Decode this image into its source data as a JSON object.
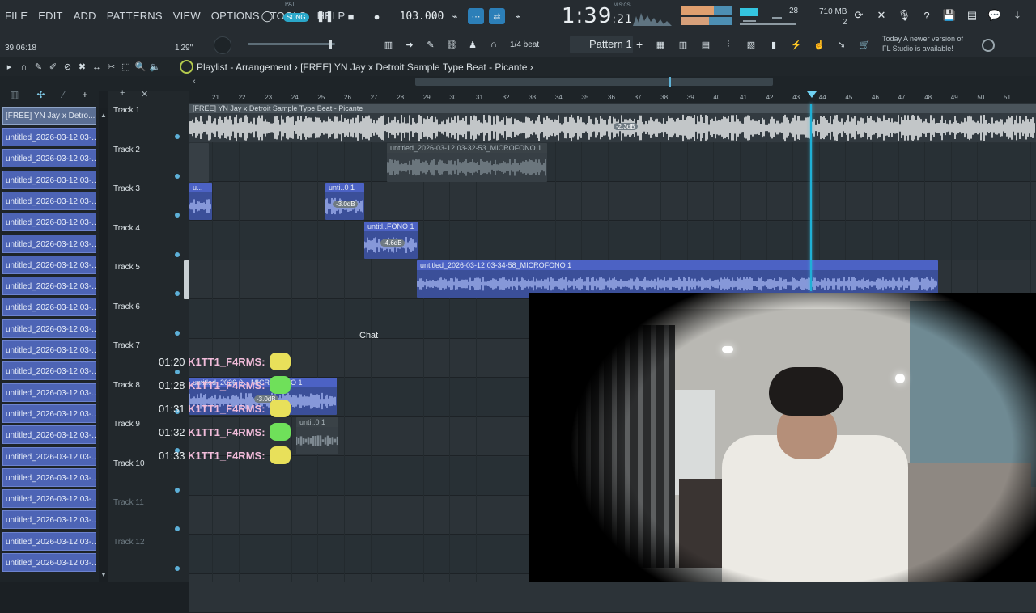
{
  "menu": [
    "FILE",
    "EDIT",
    "ADD",
    "PATTERNS",
    "VIEW",
    "OPTIONS",
    "TOOLS",
    "HELP"
  ],
  "transport": {
    "pat_label": "PAT",
    "song_label": "SONG",
    "tempo": "103.000",
    "time_main": "1:39",
    "time_sub": ":21",
    "time_unit": "M:S:CS"
  },
  "meters": {
    "cpu": "28",
    "memory": "710 MB",
    "poly": "2"
  },
  "secondbar": {
    "elapsed": "39:06:18",
    "position": "1'29\"",
    "snap": "1/4 beat",
    "pattern": "Pattern 1",
    "news_line1": "Today  A newer version of",
    "news_line2": "FL Studio is available!"
  },
  "playlist": {
    "title": "Playlist - Arrangement",
    "separator": "›",
    "project": "[FREE] YN Jay x Detroit Sample Type Beat - Picante"
  },
  "picker": {
    "header": "[FREE] YN Jay x Detro...",
    "items": [
      "untitled_2026-03-12 03-...",
      "untitled_2026-03-12 03-...",
      "untitled_2026-03-12 03-...",
      "untitled_2026-03-12 03-...",
      "untitled_2026-03-12 03-...",
      "untitled_2026-03-12 03-...",
      "untitled_2026-03-12 03-...",
      "untitled_2026-03-12 03-...",
      "untitled_2026-03-12 03-...",
      "untitled_2026-03-12 03-...",
      "untitled_2026-03-12 03-...",
      "untitled_2026-03-12 03-...",
      "untitled_2026-03-12 03-...",
      "untitled_2026-03-12 03-...",
      "untitled_2026-03-12 03-...",
      "untitled_2026-03-12 03-...",
      "untitled_2026-03-12 03-...",
      "untitled_2026-03-12 03-...",
      "untitled_2026-03-12 03-...",
      "untitled_2026-03-12 03-...",
      "untitled_2026-03-12 03-..."
    ]
  },
  "tracks": [
    "Track 1",
    "Track 2",
    "Track 3",
    "Track 4",
    "Track 5",
    "Track 6",
    "Track 7",
    "Track 8",
    "Track 9",
    "Track 10",
    "Track 11",
    "Track 12"
  ],
  "ruler": [
    "21",
    "22",
    "23",
    "24",
    "25",
    "26",
    "27",
    "28",
    "29",
    "30",
    "31",
    "32",
    "33",
    "34",
    "35",
    "36",
    "37",
    "38",
    "39",
    "40",
    "41",
    "42",
    "43",
    "44",
    "45",
    "46",
    "47",
    "48",
    "49",
    "50",
    "51"
  ],
  "clips": {
    "track1": "[FREE] YN Jay x Detroit Sample Type Beat - Picante",
    "track1_gain": "-2.3dB",
    "track2": "untitled_2026-03-12 03-32-53_MICROFONO 1",
    "track3a": "u...",
    "track3b": "unti..0 1",
    "track3_gain": "-3.0dB",
    "track4": "untitl..FONO 1",
    "track4_gain": "-4.6dB",
    "track5": "untitled_2026-03-12 03-34-58_MICROFONO 1",
    "track8": "untitled_2026-0... MICROFONO 1",
    "track8_gain": "-3.0dB",
    "track9": "unti..0 1"
  },
  "chat": {
    "label": "Chat",
    "lines": [
      {
        "time": "01:20",
        "user": "K1TT1_F4RMS:"
      },
      {
        "time": "01:28",
        "user": "K1TT1_F4RMS:"
      },
      {
        "time": "01:31",
        "user": "K1TT1_F4RMS:"
      },
      {
        "time": "01:32",
        "user": "K1TT1_F4RMS:"
      },
      {
        "time": "01:33",
        "user": "K1TT1_F4RMS:"
      }
    ]
  },
  "colors": {
    "accent": "#2aa7c9",
    "clip_blue": "#4c62c4",
    "playhead": "#1fb0d6"
  }
}
